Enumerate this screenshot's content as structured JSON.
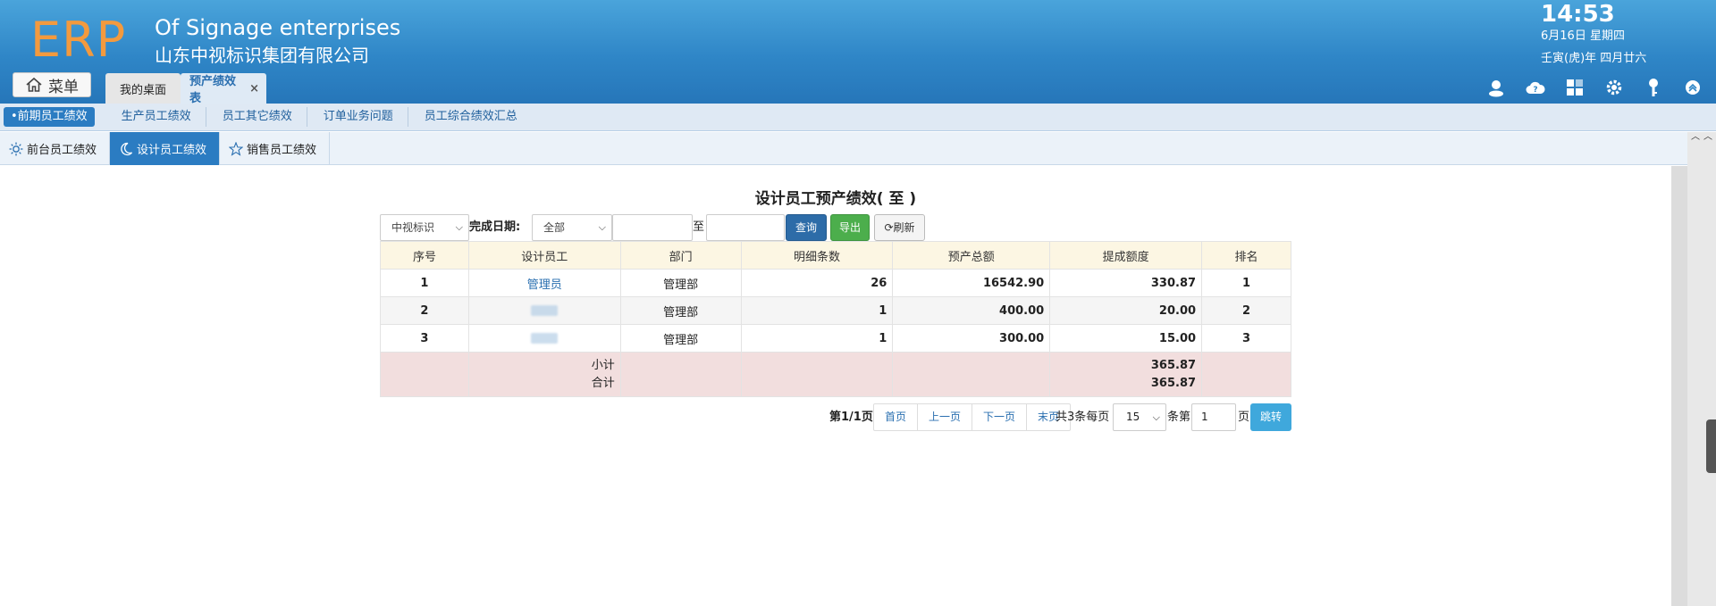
{
  "header": {
    "logo": "ERP",
    "title_en": "Of Signage enterprises",
    "title_cn": "山东中视标识集团有限公司",
    "time": "14:53",
    "date": "6月16日 星期四",
    "lunar": "壬寅(虎)年 四月廿六",
    "menu_label": "菜单",
    "tabs": [
      {
        "label": "我的桌面"
      },
      {
        "label": "预产绩效表",
        "close": "×"
      }
    ],
    "tool_icons": [
      "user-icon",
      "cloud-help-icon",
      "apps-icon",
      "gear-icon",
      "key-icon",
      "collapse-icon"
    ]
  },
  "subnav": {
    "items": [
      {
        "label": "•前期员工绩效"
      },
      {
        "label": "生产员工绩效"
      },
      {
        "label": "员工其它绩效"
      },
      {
        "label": "订单业务问题"
      },
      {
        "label": "员工综合绩效汇总"
      }
    ]
  },
  "subtabs": [
    {
      "label": "前台员工绩效",
      "icon": "sun-icon"
    },
    {
      "label": "设计员工绩效",
      "icon": "moon-icon"
    },
    {
      "label": "销售员工绩效",
      "icon": "star-icon"
    }
  ],
  "report": {
    "title": "设计员工预产绩效( 至 )",
    "filters": {
      "company": "中视标识",
      "date_label": "完成日期:",
      "date_scope": "全部",
      "to_label": "至",
      "query_label": "查询",
      "export_label": "导出",
      "refresh_label": "刷新"
    },
    "columns": [
      "序号",
      "设计员工",
      "部门",
      "明细条数",
      "预产总额",
      "提成额度",
      "排名"
    ],
    "rows": [
      {
        "no": "1",
        "name": "管理员",
        "dept": "管理部",
        "count": "26",
        "total": "16542.90",
        "commission": "330.87",
        "rank": "1"
      },
      {
        "no": "2",
        "name": "",
        "dept": "管理部",
        "count": "1",
        "total": "400.00",
        "commission": "20.00",
        "rank": "2"
      },
      {
        "no": "3",
        "name": "",
        "dept": "管理部",
        "count": "1",
        "total": "300.00",
        "commission": "15.00",
        "rank": "3"
      }
    ],
    "summary": {
      "subtotal_label": "小计",
      "total_label": "合计",
      "subtotal_commission": "365.87",
      "total_commission": "365.87"
    }
  },
  "pager": {
    "page_info": "第1/1页",
    "first": "首页",
    "prev": "上一页",
    "next": "下一页",
    "last": "末页",
    "count_text": "共3条每页",
    "page_size": "15",
    "jump_prefix": "条第",
    "page_input": "1",
    "page_suffix": "页",
    "go": "跳转"
  }
}
